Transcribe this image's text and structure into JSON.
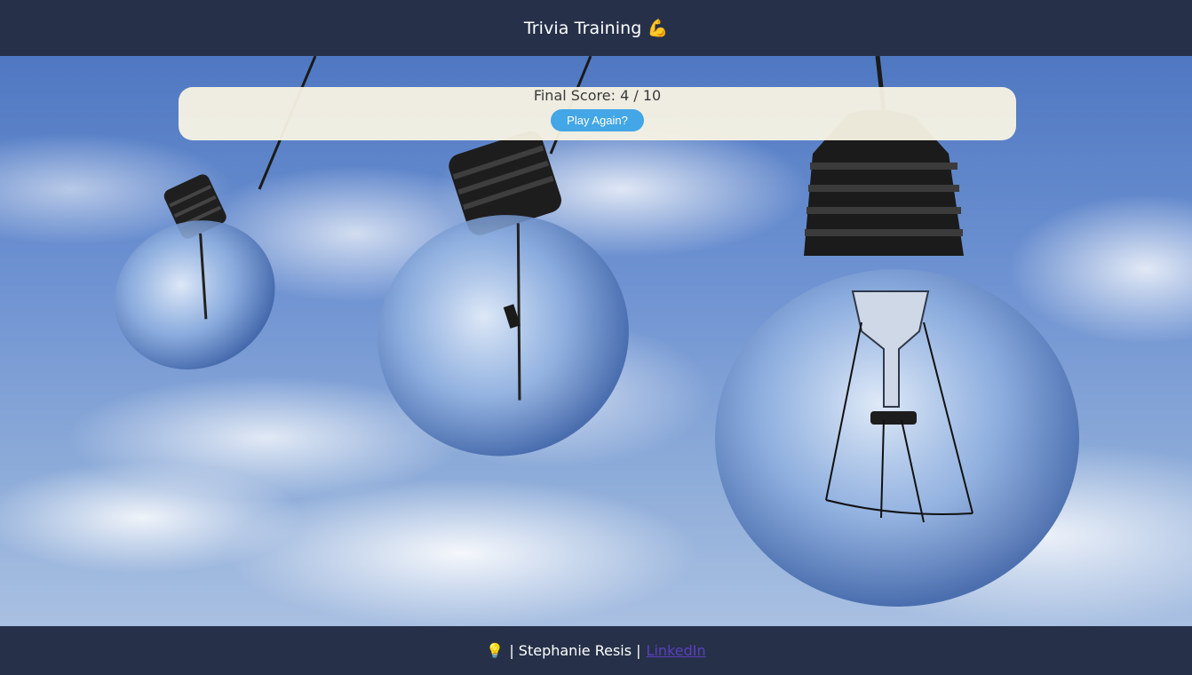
{
  "header": {
    "title": "Trivia Training",
    "emoji": "💪"
  },
  "score": {
    "label": "Final Score:",
    "value": "4 / 10"
  },
  "actions": {
    "play_again_label": "Play Again?"
  },
  "footer": {
    "bulb_emoji": "💡",
    "text": "| Stephanie Resis |",
    "link_label": "LinkedIn"
  },
  "colors": {
    "header_bg": "#263149",
    "card_bg": "#F8F3E4",
    "button_bg": "#43A6E6",
    "link": "#5A3FC0"
  }
}
